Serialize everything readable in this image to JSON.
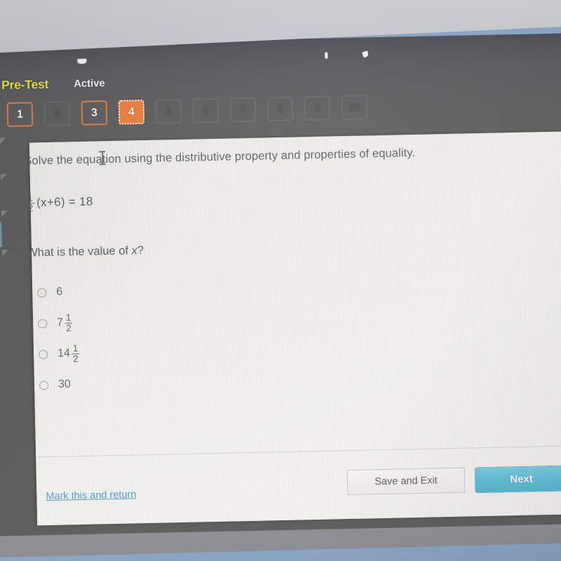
{
  "header": {
    "test_name": "Pre-Test",
    "status": "Active"
  },
  "pager": {
    "items": [
      {
        "label": "1",
        "state": "visited"
      },
      {
        "label": "2",
        "state": "dim"
      },
      {
        "label": "3",
        "state": "visited"
      },
      {
        "label": "4",
        "state": "current"
      },
      {
        "label": "5",
        "state": "dim"
      },
      {
        "label": "6",
        "state": "dim"
      },
      {
        "label": "7",
        "state": "dim"
      },
      {
        "label": "8",
        "state": "dim"
      },
      {
        "label": "9",
        "state": "dim"
      },
      {
        "label": "10",
        "state": "dim"
      }
    ]
  },
  "question": {
    "prompt": "Solve the equation using the distributive property and properties of equality.",
    "equation": {
      "coefficient_numerator": "1",
      "coefficient_denominator": "2",
      "expression": "(x+6) = 18"
    },
    "subprompt_before": "What is the value of ",
    "subprompt_variable": "x",
    "subprompt_after": "?",
    "options": [
      {
        "label": "6",
        "whole": "6",
        "numerator": "",
        "denominator": ""
      },
      {
        "label": "7 1/2",
        "whole": "7",
        "numerator": "1",
        "denominator": "2"
      },
      {
        "label": "14 1/2",
        "whole": "14",
        "numerator": "1",
        "denominator": "2"
      },
      {
        "label": "30",
        "whole": "30",
        "numerator": "",
        "denominator": ""
      }
    ]
  },
  "footer": {
    "mark_link": "Mark this and return",
    "save_exit": "Save and Exit",
    "next": "Next"
  },
  "colors": {
    "accent_orange": "#ea7c3f",
    "pretest_yellow": "#e8e04a",
    "next_cyan": "#63bcd6",
    "link_blue": "#4f9fc4"
  }
}
